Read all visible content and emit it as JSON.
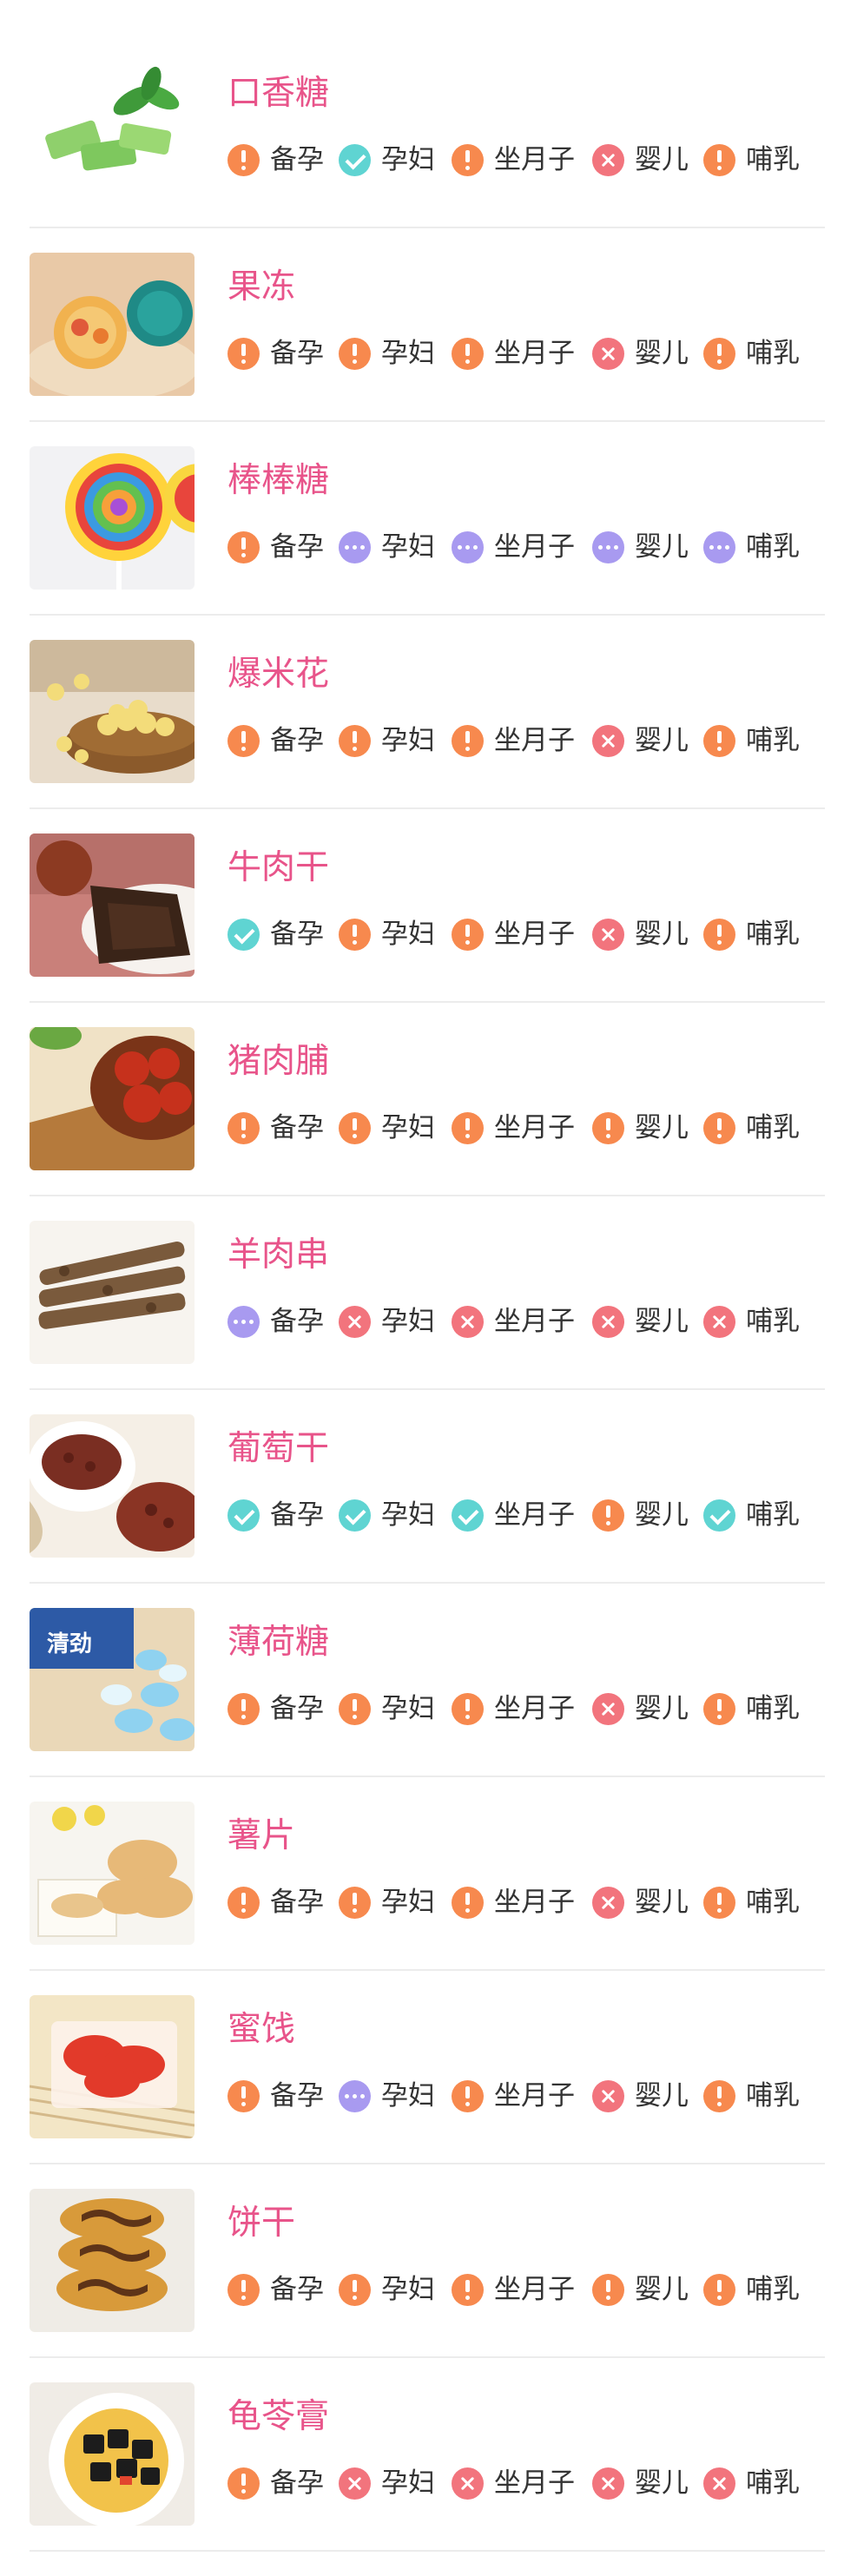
{
  "colors": {
    "title": "#e8548a",
    "warn": "#f7894e",
    "ok": "#5fd4d2",
    "no": "#f2747d",
    "unknown": "#a89af0",
    "divider": "#ececec"
  },
  "status_icons": {
    "warn": "exclamation-icon",
    "ok": "check-icon",
    "no": "cross-icon",
    "unk": "ellipsis-icon"
  },
  "foods": [
    {
      "name": "口香糖",
      "image": "chewing-gum-thumbnail",
      "statuses": [
        "warn",
        "ok",
        "warn",
        "no",
        "warn"
      ]
    },
    {
      "name": "果冻",
      "image": "jelly-thumbnail",
      "statuses": [
        "warn",
        "warn",
        "warn",
        "no",
        "warn"
      ]
    },
    {
      "name": "棒棒糖",
      "image": "lollipop-thumbnail",
      "statuses": [
        "warn",
        "unk",
        "unk",
        "unk",
        "unk"
      ]
    },
    {
      "name": "爆米花",
      "image": "popcorn-thumbnail",
      "statuses": [
        "warn",
        "warn",
        "warn",
        "no",
        "warn"
      ]
    },
    {
      "name": "牛肉干",
      "image": "beef-jerky-thumbnail",
      "statuses": [
        "ok",
        "warn",
        "warn",
        "no",
        "warn"
      ]
    },
    {
      "name": "猪肉脯",
      "image": "pork-jerky-thumbnail",
      "statuses": [
        "warn",
        "warn",
        "warn",
        "warn",
        "warn"
      ]
    },
    {
      "name": "羊肉串",
      "image": "lamb-kebab-thumbnail",
      "statuses": [
        "unk",
        "no",
        "no",
        "no",
        "no"
      ]
    },
    {
      "name": "葡萄干",
      "image": "raisins-thumbnail",
      "statuses": [
        "ok",
        "ok",
        "ok",
        "warn",
        "ok"
      ]
    },
    {
      "name": "薄荷糖",
      "image": "mint-candy-thumbnail",
      "statuses": [
        "warn",
        "warn",
        "warn",
        "no",
        "warn"
      ]
    },
    {
      "name": "薯片",
      "image": "potato-chips-thumbnail",
      "statuses": [
        "warn",
        "warn",
        "warn",
        "no",
        "warn"
      ]
    },
    {
      "name": "蜜饯",
      "image": "candied-fruit-thumbnail",
      "statuses": [
        "warn",
        "unk",
        "warn",
        "no",
        "warn"
      ]
    },
    {
      "name": "饼干",
      "image": "biscuit-thumbnail",
      "statuses": [
        "warn",
        "warn",
        "warn",
        "warn",
        "warn"
      ]
    },
    {
      "name": "龟苓膏",
      "image": "herbal-jelly-thumbnail",
      "statuses": [
        "warn",
        "no",
        "no",
        "no",
        "no"
      ]
    }
  ],
  "tag_labels": [
    "备孕",
    "孕妇",
    "坐月子",
    "婴儿",
    "哺乳"
  ]
}
